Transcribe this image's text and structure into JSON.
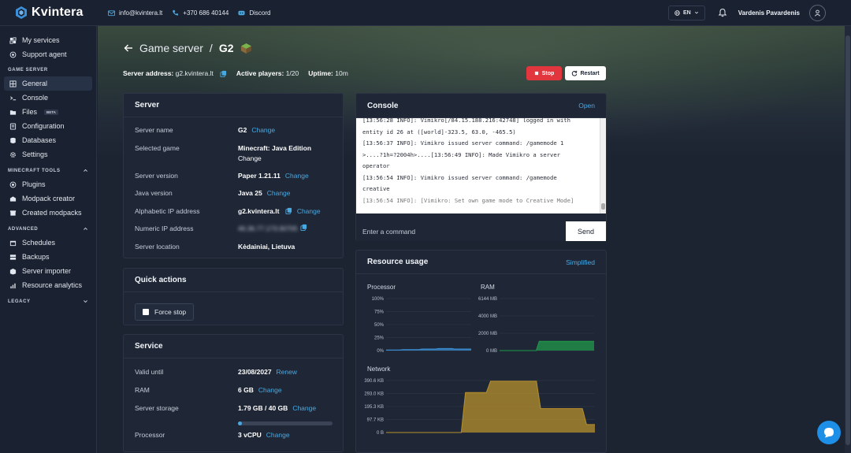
{
  "brand": {
    "name": "Kvintera"
  },
  "header": {
    "email": "info@kvintera.lt",
    "phone": "+370 686 40144",
    "discord": "Discord",
    "language": "EN",
    "user_name": "Vardenis Pavardenis"
  },
  "sidebar": {
    "top_items": [
      {
        "label": "My services",
        "icon": "servers-icon"
      },
      {
        "label": "Support agent",
        "icon": "support-icon"
      }
    ],
    "section_game_server": "GAME SERVER",
    "game_items": [
      {
        "label": "General",
        "icon": "grid-icon",
        "active": true
      },
      {
        "label": "Console",
        "icon": "terminal-icon"
      },
      {
        "label": "Files",
        "icon": "folder-icon",
        "badge": "BETA"
      },
      {
        "label": "Configuration",
        "icon": "config-icon"
      },
      {
        "label": "Databases",
        "icon": "database-icon"
      },
      {
        "label": "Settings",
        "icon": "gear-icon"
      }
    ],
    "section_minecraft": "MINECRAFT TOOLS",
    "minecraft_items": [
      {
        "label": "Plugins",
        "icon": "plugin-icon"
      },
      {
        "label": "Modpack creator",
        "icon": "modpack-icon"
      },
      {
        "label": "Created modpacks",
        "icon": "box-icon"
      }
    ],
    "section_advanced": "ADVANCED",
    "advanced_items": [
      {
        "label": "Schedules",
        "icon": "calendar-icon"
      },
      {
        "label": "Backups",
        "icon": "backup-icon"
      },
      {
        "label": "Server importer",
        "icon": "import-icon"
      },
      {
        "label": "Resource analytics",
        "icon": "analytics-icon"
      }
    ],
    "section_legacy": "LEGACY"
  },
  "page": {
    "breadcrumb_parent": "Game server",
    "breadcrumb_sep": "/",
    "breadcrumb_current": "G2",
    "server_address_label": "Server address:",
    "server_address": "g2.kvintera.lt",
    "active_players_label": "Active players:",
    "active_players": "1/20",
    "uptime_label": "Uptime:",
    "uptime": "10m",
    "stop_label": "Stop",
    "restart_label": "Restart"
  },
  "server_card": {
    "title": "Server",
    "change": "Change",
    "rows": {
      "name_label": "Server name",
      "name_value": "G2",
      "game_label": "Selected game",
      "game_value": "Minecraft: Java Edition",
      "version_label": "Server version",
      "version_value": "Paper 1.21.11",
      "java_label": "Java version",
      "java_value": "Java 25",
      "alpha_ip_label": "Alphabetic IP address",
      "alpha_ip_value": "g2.kvintera.lt",
      "numeric_ip_label": "Numeric IP address",
      "numeric_ip_value": "46.36.77.173:30705",
      "location_label": "Server location",
      "location_value": "Kėdainiai, Lietuva"
    }
  },
  "quick_actions": {
    "title": "Quick actions",
    "force_stop": "Force stop"
  },
  "service_card": {
    "title": "Service",
    "valid_label": "Valid until",
    "valid_value": "23/08/2027",
    "renew": "Renew",
    "ram_label": "RAM",
    "ram_value": "6 GB",
    "storage_label": "Server storage",
    "storage_value": "1.79 GB / 40 GB",
    "storage_fraction": 0.045,
    "cpu_label": "Processor",
    "cpu_value": "3 vCPU",
    "change": "Change"
  },
  "console": {
    "title": "Console",
    "open": "Open",
    "lines": [
      "[13:56:28 INFO]: Vimikro[/84.15.188.216:42748] logged in with",
      "entity id 26 at ([world]-323.5, 63.0, -465.5)",
      "[13:56:37 INFO]: Vimikro issued server command: /gamemode 1",
      ">....?1h=?2004h>....[13:56:49 INFO]: Made Vimikro a server",
      "operator",
      "[13:56:54 INFO]: Vimikro issued server command: /gamemode",
      "creative",
      "[13:56:54 INFO]: [Vimikro: Set own game mode to Creative Mode]"
    ],
    "input_placeholder": "Enter a command",
    "send": "Send"
  },
  "resources": {
    "title": "Resource usage",
    "simplified": "Simplified",
    "processor_label": "Processor",
    "ram_label": "RAM",
    "network_label": "Network",
    "colors": {
      "cpu": "#3b8fd6",
      "ram": "#1f9a4a",
      "network": "#b7902c"
    }
  },
  "chart_data": [
    {
      "type": "area",
      "title": "Processor",
      "y_ticks": [
        "100%",
        "75%",
        "50%",
        "25%",
        "0%"
      ],
      "ylim": [
        0,
        100
      ],
      "values": [
        1,
        1,
        1,
        1,
        1,
        1,
        2,
        2,
        2,
        2,
        2,
        2,
        2,
        3,
        3,
        3,
        3,
        3,
        3,
        4,
        4,
        4,
        4,
        4,
        4,
        3,
        3,
        3,
        3,
        3,
        3,
        3
      ]
    },
    {
      "type": "area",
      "title": "RAM",
      "y_ticks": [
        "6144 MB",
        "4000 MB",
        "2000 MB",
        "0 MB"
      ],
      "ylim": [
        0,
        6144
      ],
      "values": [
        0,
        0,
        0,
        0,
        0,
        0,
        0,
        0,
        0,
        0,
        0,
        0,
        0,
        1100,
        1100,
        1100,
        1100,
        1100,
        1100,
        1100,
        1100,
        1100,
        1100,
        1100,
        1100,
        1100,
        1100,
        1100,
        1100,
        1100,
        1100,
        1100
      ]
    },
    {
      "type": "area",
      "title": "Network",
      "y_ticks": [
        "390.6 KB",
        "293.0 KB",
        "195.3 KB",
        "97.7 KB",
        "0 B"
      ],
      "ylim": [
        0,
        390.6
      ],
      "values": [
        0,
        0,
        0,
        0,
        0,
        0,
        0,
        0,
        0,
        0,
        0,
        0,
        0,
        0,
        0,
        0,
        0,
        0,
        0,
        300,
        300,
        300,
        300,
        300,
        300,
        385,
        385,
        385,
        385,
        385,
        385,
        385,
        385,
        385,
        385,
        385,
        385,
        180,
        180,
        180,
        180,
        180,
        180,
        180,
        180,
        180,
        180,
        180,
        60,
        60,
        60
      ]
    }
  ]
}
